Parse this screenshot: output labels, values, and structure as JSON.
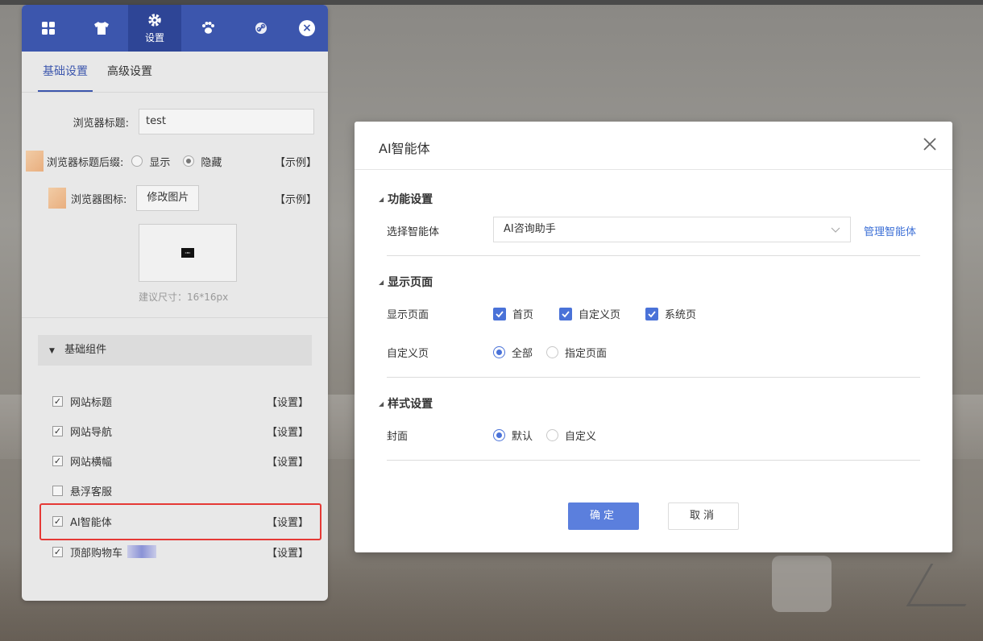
{
  "panel": {
    "tabs": [
      {
        "icon": "grid-icon",
        "label": ""
      },
      {
        "icon": "shirt-icon",
        "label": ""
      },
      {
        "icon": "gear-icon",
        "label": "设置"
      },
      {
        "icon": "paw-icon",
        "label": ""
      },
      {
        "icon": "link-icon",
        "label": ""
      }
    ],
    "close_symbol": "×",
    "subtabs": [
      "基础设置",
      "高级设置"
    ],
    "browser_title_label": "浏览器标题:",
    "browser_title_value": "test",
    "title_suffix_label": "浏览器标题后缀:",
    "suffix_options": [
      "显示",
      "隐藏"
    ],
    "suffix_selected": "隐藏",
    "example": "【示例】",
    "favicon_label": "浏览器图标:",
    "modify_image": "修改图片",
    "logo_text": "CMC",
    "size_hint": "建议尺寸：16*16px",
    "group_title": "基础组件",
    "components": [
      {
        "label": "网站标题",
        "checked": true,
        "action": "【设置】"
      },
      {
        "label": "网站导航",
        "checked": true,
        "action": "【设置】"
      },
      {
        "label": "网站横幅",
        "checked": true,
        "action": "【设置】"
      },
      {
        "label": "悬浮客服",
        "checked": false,
        "action": ""
      },
      {
        "label": "AI智能体",
        "checked": true,
        "action": "【设置】"
      },
      {
        "label": "顶部购物车",
        "checked": true,
        "action": "【设置】"
      }
    ]
  },
  "dialog": {
    "title": "AI智能体",
    "section_function": "功能设置",
    "select_agent_label": "选择智能体",
    "select_agent_value": "AI咨询助手",
    "manage_link": "管理智能体",
    "section_display": "显示页面",
    "display_pages_label": "显示页面",
    "display_pages": [
      {
        "label": "首页",
        "checked": true
      },
      {
        "label": "自定义页",
        "checked": true
      },
      {
        "label": "系统页",
        "checked": true
      }
    ],
    "custom_page_label": "自定义页",
    "custom_page_options": [
      "全部",
      "指定页面"
    ],
    "custom_page_selected": "全部",
    "section_style": "样式设置",
    "cover_label": "封面",
    "cover_options": [
      "默认",
      "自定义"
    ],
    "cover_selected": "默认",
    "confirm": "确定",
    "cancel": "取消"
  },
  "colors": {
    "accent": "#3c56ad",
    "dialog_accent": "#4a72d8",
    "highlight": "#e53935"
  }
}
